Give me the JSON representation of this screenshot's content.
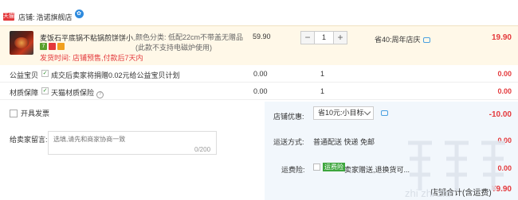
{
  "store": {
    "badge": "天猫",
    "label": "店铺:",
    "name": "浩诺旗舰店",
    "ww_icon": "ww-chat-icon"
  },
  "item": {
    "title": "麦饭石平底锅不粘锅煎饼饼小...",
    "tag_7": "7",
    "delivery_note": "发货时间:   店铺预售,付款后7天内",
    "sku": "颜色分类: 低配22cm不带盖无赠品 (此款不支持电磁炉使用)",
    "price": "59.90",
    "qty_minus": "−",
    "qty_value": "1",
    "qty_plus": "+",
    "promo": "省40:周年店庆",
    "total": "19.90"
  },
  "services": [
    {
      "label": "公益宝贝",
      "text": "成交后卖家将捐赠0.02元给公益宝贝计划",
      "price": "0.00",
      "qty": "1",
      "total": "0.00",
      "checked": true,
      "help": false
    },
    {
      "label": "材质保障",
      "text": "天猫材质保险",
      "price": "0.00",
      "qty": "1",
      "total": "0.00",
      "checked": true,
      "help": true
    }
  ],
  "invoice": {
    "label": "开具发票"
  },
  "discount": {
    "label": "店铺优惠:",
    "selected": "省10元:小目标",
    "amount": "-10.00"
  },
  "message": {
    "label": "给卖家留言:",
    "placeholder": "选填,请先和商家协商一致",
    "count": "0/200"
  },
  "shipping": {
    "label": "运送方式:",
    "value": "普通配送 快递 免邮",
    "amount": "0.00"
  },
  "freight": {
    "label": "运费险:",
    "badge": "运费险",
    "text": "卖家赠送,退换货可...",
    "amount": "0.00"
  },
  "bottom": {
    "label": "店铺合计(含运费)",
    "amount": "¥9.90"
  },
  "watermark": {
    "text": "值 值 值",
    "sub": "zhi zhi zhi"
  },
  "colors": {
    "accent": "#e4393c",
    "panel": "#f2f7fc",
    "item_bg": "#fff8e8"
  }
}
